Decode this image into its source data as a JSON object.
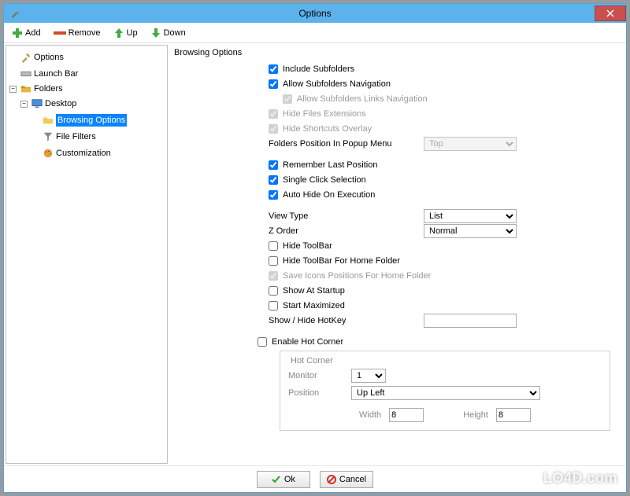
{
  "window": {
    "title": "Options"
  },
  "toolbar": {
    "add": "Add",
    "remove": "Remove",
    "up": "Up",
    "down": "Down"
  },
  "tree": {
    "options": "Options",
    "launch_bar": "Launch Bar",
    "folders": "Folders",
    "desktop": "Desktop",
    "browsing_options": "Browsing Options",
    "file_filters": "File Filters",
    "customization": "Customization"
  },
  "section_title": "Browsing Options",
  "opts": {
    "include_subfolders": "Include Subfolders",
    "allow_subfolders_nav": "Allow Subfolders Navigation",
    "allow_subfolders_links_nav": "Allow Subfolders Links Navigation",
    "hide_files_ext": "Hide Files Extensions",
    "hide_shortcuts_overlay": "Hide Shortcuts Overlay",
    "folders_pos_label": "Folders Position In Popup Menu",
    "folders_pos_value": "Top",
    "remember_last_pos": "Remember Last Position",
    "single_click": "Single Click Selection",
    "auto_hide": "Auto Hide On Execution",
    "view_type_label": "View Type",
    "view_type_value": "List",
    "z_order_label": "Z Order",
    "z_order_value": "Normal",
    "hide_toolbar": "Hide ToolBar",
    "hide_toolbar_home": "Hide ToolBar For Home Folder",
    "save_icons_pos": "Save Icons Positions For Home Folder",
    "show_at_startup": "Show At Startup",
    "start_maximized": "Start Maximized",
    "show_hide_hotkey_label": "Show / Hide HotKey",
    "show_hide_hotkey_value": "",
    "enable_hot_corner": "Enable Hot Corner"
  },
  "hot_corner": {
    "legend": "Hot Corner",
    "monitor_label": "Monitor",
    "monitor_value": "1",
    "position_label": "Position",
    "position_value": "Up Left",
    "width_label": "Width",
    "width_value": "8",
    "height_label": "Height",
    "height_value": "8"
  },
  "buttons": {
    "ok": "Ok",
    "cancel": "Cancel"
  },
  "watermark": "LO4D.com"
}
